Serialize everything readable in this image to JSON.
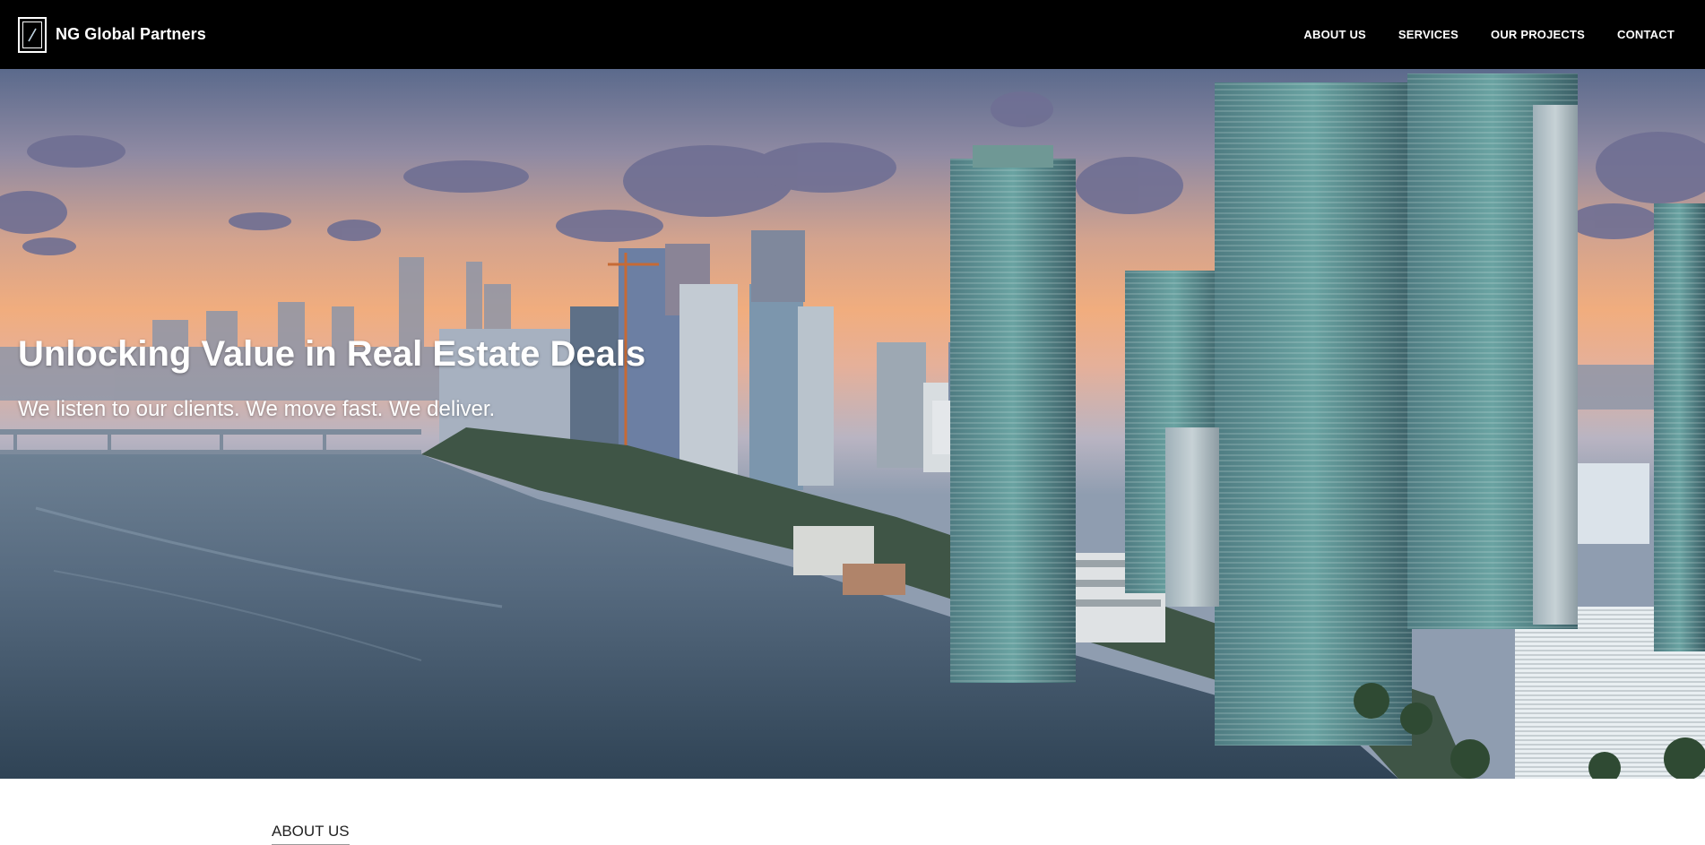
{
  "header": {
    "brand_name": "NG Global Partners",
    "logo_icon": "ng-logo-icon",
    "nav": [
      {
        "label": "ABOUT US"
      },
      {
        "label": "SERVICES"
      },
      {
        "label": "OUR PROJECTS"
      },
      {
        "label": "CONTACT"
      }
    ]
  },
  "hero": {
    "title": "Unlocking Value in Real Estate Deals",
    "subtitle": "We listen to our clients. We move fast. We deliver.",
    "image_subject": "city skyline at sunset"
  },
  "about": {
    "heading": "ABOUT US"
  },
  "colors": {
    "header_bg": "#000000",
    "header_text": "#ffffff",
    "hero_text": "#ffffff",
    "section_bg": "#ffffff"
  }
}
